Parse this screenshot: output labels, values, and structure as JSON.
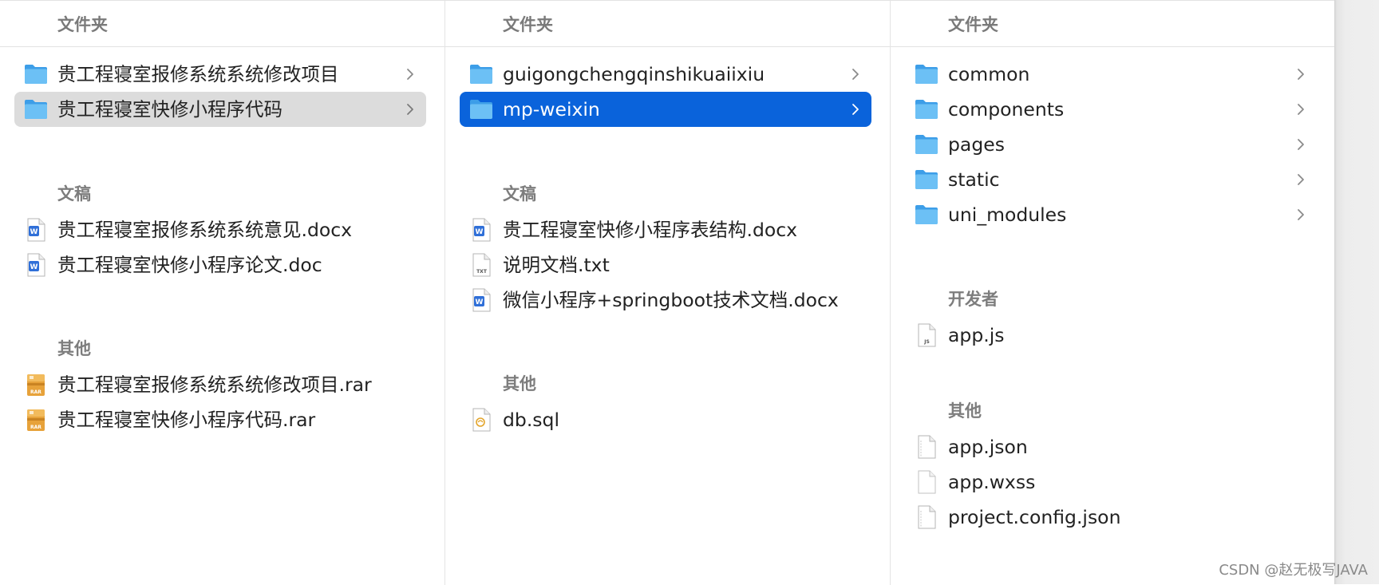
{
  "columns": [
    {
      "header": "文件夹",
      "folders": [
        {
          "name": "贵工程寝室报修系统系统修改项目",
          "selected": false
        },
        {
          "name": "贵工程寝室快修小程序代码",
          "selected": true
        }
      ],
      "sections": [
        {
          "label": "文稿",
          "items": [
            {
              "name": "贵工程寝室报修系统系统意见.docx",
              "icon": "word-doc-icon"
            },
            {
              "name": "贵工程寝室快修小程序论文.doc",
              "icon": "word-doc-icon"
            }
          ]
        },
        {
          "label": "其他",
          "items": [
            {
              "name": "贵工程寝室报修系统系统修改项目.rar",
              "icon": "rar-archive-icon"
            },
            {
              "name": "贵工程寝室快修小程序代码.rar",
              "icon": "rar-archive-icon"
            }
          ]
        }
      ]
    },
    {
      "header": "文件夹",
      "folders": [
        {
          "name": "guigongchengqinshikuaiixiu",
          "selected": false
        },
        {
          "name": "mp-weixin",
          "selected": true
        }
      ],
      "sections": [
        {
          "label": "文稿",
          "items": [
            {
              "name": "贵工程寝室快修小程序表结构.docx",
              "icon": "word-doc-icon"
            },
            {
              "name": "说明文档.txt",
              "icon": "txt-file-icon"
            },
            {
              "name": "微信小程序+springboot技术文档.docx",
              "icon": "word-doc-icon"
            }
          ]
        },
        {
          "label": "其他",
          "items": [
            {
              "name": "db.sql",
              "icon": "sql-file-icon"
            }
          ]
        }
      ]
    },
    {
      "header": "文件夹",
      "folders": [
        {
          "name": "common",
          "selected": false
        },
        {
          "name": "components",
          "selected": false
        },
        {
          "name": "pages",
          "selected": false
        },
        {
          "name": "static",
          "selected": false
        },
        {
          "name": "uni_modules",
          "selected": false
        }
      ],
      "sections": [
        {
          "label": "开发者",
          "items": [
            {
              "name": "app.js",
              "icon": "js-file-icon"
            }
          ]
        },
        {
          "label": "其他",
          "items": [
            {
              "name": "app.json",
              "icon": "json-file-icon"
            },
            {
              "name": "app.wxss",
              "icon": "blank-file-icon"
            },
            {
              "name": "project.config.json",
              "icon": "json-file-icon"
            }
          ]
        }
      ]
    }
  ],
  "watermark": "CSDN @赵无极写JAVA",
  "colors": {
    "selection_blue": "#0a63db",
    "selection_gray": "#dcdcdc",
    "folder_blue": "#59b4f0"
  },
  "icon_text": {
    "txt": "TXT",
    "js": "JS",
    "rar": "RAR",
    "word": "W"
  }
}
